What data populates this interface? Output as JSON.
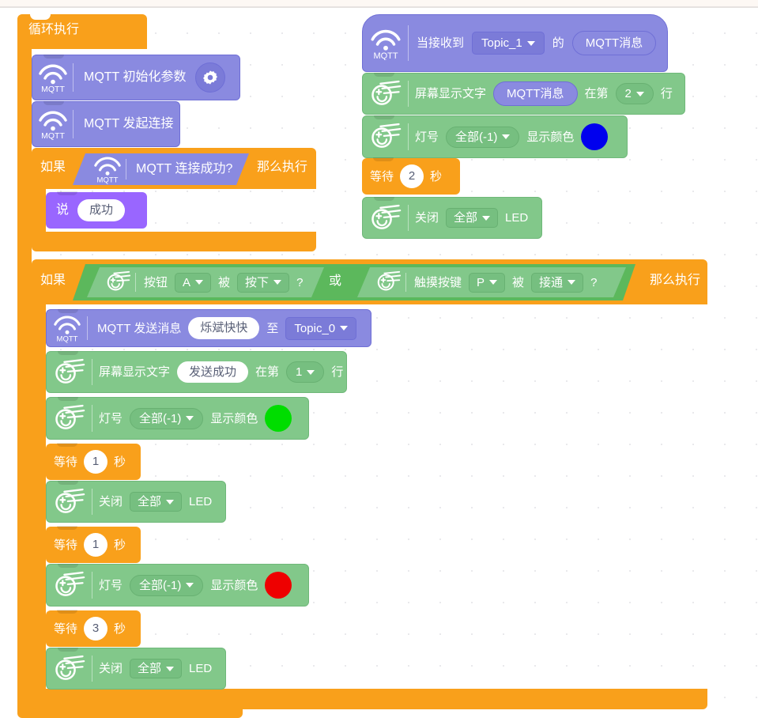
{
  "app": {
    "canvas_title": "Blockly block workspace"
  },
  "palette": {
    "control": "#f9a01b",
    "control_dark": "#e8940d",
    "mqtt": "#8a8ae0",
    "sensing_green": "#82c88a",
    "bool_green": "#5cb85c",
    "looks_purple": "#9966ff",
    "blue_swatch": "#0000ee",
    "green_swatch": "#00dd00",
    "red_swatch": "#ee0000"
  },
  "script_main": {
    "forever": {
      "label": "循环执行"
    },
    "mqtt_init": {
      "label": "MQTT 初始化参数",
      "icon": "mqtt-wifi-icon",
      "gear": "gear-icon"
    },
    "mqtt_connect": {
      "label": "MQTT 发起连接",
      "icon": "mqtt-wifi-icon"
    },
    "if_connected": {
      "if_label": "如果",
      "then_label": "那么执行",
      "condition": {
        "label": "MQTT 连接成功?",
        "icon": "mqtt-wifi-icon"
      },
      "body": {
        "say_label": "说",
        "say_value": "成功"
      }
    },
    "if_button": {
      "if_label": "如果",
      "then_label": "那么执行",
      "or_label": "或",
      "cond_a": {
        "prefix": "按钮",
        "port": "A",
        "mid": "被",
        "state": "按下",
        "suffix": "?",
        "icon": "board-icon"
      },
      "cond_b": {
        "prefix": "触摸按键",
        "port": "P",
        "mid": "被",
        "state": "接通",
        "suffix": "?",
        "icon": "board-icon"
      },
      "body": [
        {
          "type": "mqtt_publish",
          "icon": "mqtt-wifi-icon",
          "prefix": "MQTT 发送消息",
          "message": "烁斌快快",
          "mid": "至",
          "topic": "Topic_0"
        },
        {
          "type": "screen_text",
          "icon": "board-icon",
          "prefix": "屏幕显示文字",
          "text": "发送成功",
          "mid": "在第",
          "line": "1",
          "suffix": "行"
        },
        {
          "type": "led_color",
          "icon": "board-icon",
          "prefix": "灯号",
          "which": "全部(-1)",
          "mid": "显示颜色",
          "color": "#00dd00"
        },
        {
          "type": "wait",
          "prefix": "等待",
          "value": "1",
          "suffix": "秒"
        },
        {
          "type": "led_off",
          "icon": "board-icon",
          "prefix": "关闭",
          "which": "全部",
          "suffix": "LED"
        },
        {
          "type": "wait",
          "prefix": "等待",
          "value": "1",
          "suffix": "秒"
        },
        {
          "type": "led_color",
          "icon": "board-icon",
          "prefix": "灯号",
          "which": "全部(-1)",
          "mid": "显示颜色",
          "color": "#ee0000"
        },
        {
          "type": "wait",
          "prefix": "等待",
          "value": "3",
          "suffix": "秒"
        },
        {
          "type": "led_off",
          "icon": "board-icon",
          "prefix": "关闭",
          "which": "全部",
          "suffix": "LED"
        }
      ]
    }
  },
  "script_hat": {
    "hat": {
      "icon": "mqtt-wifi-icon",
      "prefix": "当接收到",
      "topic": "Topic_1",
      "mid": "的",
      "reporter": "MQTT消息"
    },
    "body": [
      {
        "type": "screen_text",
        "icon": "board-icon",
        "prefix": "屏幕显示文字",
        "reporter": "MQTT消息",
        "mid": "在第",
        "line": "2",
        "suffix": "行"
      },
      {
        "type": "led_color",
        "icon": "board-icon",
        "prefix": "灯号",
        "which": "全部(-1)",
        "mid": "显示颜色",
        "color": "#0000ee"
      },
      {
        "type": "wait",
        "prefix": "等待",
        "value": "2",
        "suffix": "秒"
      },
      {
        "type": "led_off",
        "icon": "board-icon",
        "prefix": "关闭",
        "which": "全部",
        "suffix": "LED"
      }
    ]
  }
}
